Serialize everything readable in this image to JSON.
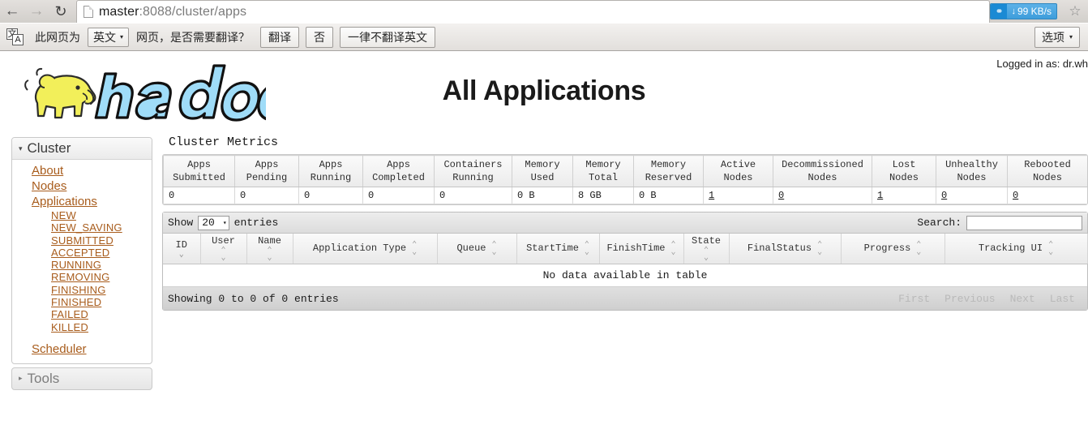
{
  "browser": {
    "back_icon": "back-arrow-icon",
    "forward_icon": "forward-arrow-icon",
    "reload_icon": "reload-icon",
    "url_host": "master",
    "url_rest": ":8088/cluster/apps",
    "download_speed": "99 KB/s",
    "download_arrow": "↓",
    "star_glyph": "☆"
  },
  "translate_bar": {
    "icon_primary": "文",
    "icon_secondary": "A",
    "prefix": "此网页为",
    "language": "英文",
    "suffix": "网页，是否需要翻译？",
    "translate_label": "翻译",
    "no_label": "否",
    "never_label": "一律不翻译英文",
    "options_label": "选项",
    "caret": "▾"
  },
  "header": {
    "logged_in": "Logged in as: dr.wh",
    "title": "All Applications",
    "logo_alt": "hadoop-logo"
  },
  "sidebar": {
    "cluster": {
      "title": "Cluster",
      "triangle": "▾",
      "links": [
        {
          "label": "About",
          "level": "top"
        },
        {
          "label": "Nodes",
          "level": "top"
        },
        {
          "label": "Applications",
          "level": "top"
        },
        {
          "label": "NEW",
          "level": "sub"
        },
        {
          "label": "NEW_SAVING",
          "level": "sub"
        },
        {
          "label": "SUBMITTED",
          "level": "sub"
        },
        {
          "label": "ACCEPTED",
          "level": "sub"
        },
        {
          "label": "RUNNING",
          "level": "sub"
        },
        {
          "label": "REMOVING",
          "level": "sub"
        },
        {
          "label": "FINISHING",
          "level": "sub"
        },
        {
          "label": "FINISHED",
          "level": "sub"
        },
        {
          "label": "FAILED",
          "level": "sub"
        },
        {
          "label": "KILLED",
          "level": "sub"
        },
        {
          "label": "Scheduler",
          "level": "top-gap"
        }
      ]
    },
    "tools": {
      "title": "Tools",
      "triangle": "▸"
    }
  },
  "metrics": {
    "title": "Cluster Metrics",
    "columns": [
      {
        "line1": "Apps",
        "line2": "Submitted"
      },
      {
        "line1": "Apps",
        "line2": "Pending"
      },
      {
        "line1": "Apps",
        "line2": "Running"
      },
      {
        "line1": "Apps",
        "line2": "Completed"
      },
      {
        "line1": "Containers",
        "line2": "Running"
      },
      {
        "line1": "Memory",
        "line2": "Used"
      },
      {
        "line1": "Memory",
        "line2": "Total"
      },
      {
        "line1": "Memory",
        "line2": "Reserved"
      },
      {
        "line1": "Active",
        "line2": "Nodes"
      },
      {
        "line1": "Decommissioned",
        "line2": "Nodes"
      },
      {
        "line1": "Lost",
        "line2": "Nodes"
      },
      {
        "line1": "Unhealthy",
        "line2": "Nodes"
      },
      {
        "line1": "Rebooted",
        "line2": "Nodes"
      }
    ],
    "values": [
      "0",
      "0",
      "0",
      "0",
      "0",
      "0 B",
      "8 GB",
      "0 B",
      "1",
      "0",
      "1",
      "0",
      "0"
    ],
    "link_flags": [
      false,
      false,
      false,
      false,
      false,
      false,
      false,
      false,
      true,
      true,
      true,
      true,
      true
    ]
  },
  "apps": {
    "show_label": "Show",
    "entries_label": "entries",
    "page_length": "20",
    "caret": "▾",
    "search_label": "Search:",
    "search_value": "",
    "search_placeholder": "",
    "columns": [
      {
        "label": "ID",
        "sort": "desc",
        "stacked": true
      },
      {
        "label": "User",
        "sort": "both",
        "stacked": true
      },
      {
        "label": "Name",
        "sort": "both",
        "stacked": true
      },
      {
        "label": "Application Type",
        "sort": "both",
        "stacked": false
      },
      {
        "label": "Queue",
        "sort": "both",
        "stacked": false
      },
      {
        "label": "StartTime",
        "sort": "both",
        "stacked": false
      },
      {
        "label": "FinishTime",
        "sort": "both",
        "stacked": false
      },
      {
        "label": "State",
        "sort": "both",
        "stacked": true
      },
      {
        "label": "FinalStatus",
        "sort": "both",
        "stacked": false
      },
      {
        "label": "Progress",
        "sort": "both",
        "stacked": false
      },
      {
        "label": "Tracking UI",
        "sort": "both",
        "stacked": false
      }
    ],
    "empty_message": "No data available in table",
    "info": "Showing 0 to 0 of 0 entries",
    "paging": [
      "First",
      "Previous",
      "Next",
      "Last"
    ]
  },
  "colors": {
    "link": "#a85c1c",
    "accent_blue": "#3e9ddb",
    "logo_yellow": "#f2ef5a",
    "logo_blue": "#9fdcf8"
  }
}
